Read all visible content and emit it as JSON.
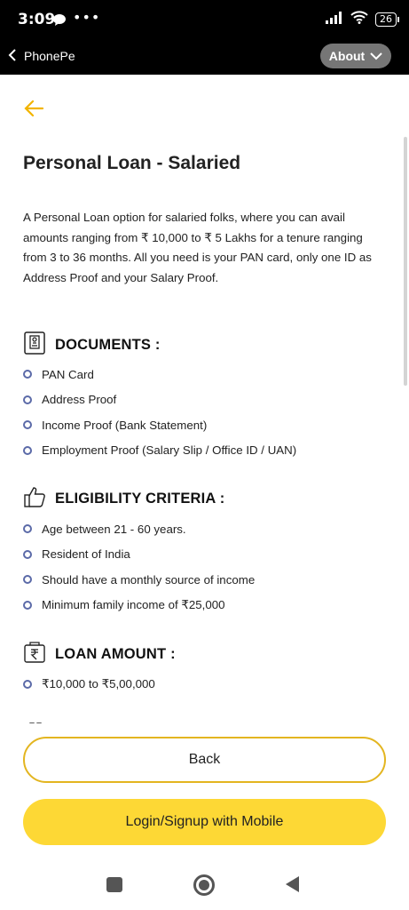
{
  "status_bar": {
    "time": "3:09",
    "dots": "•••",
    "battery": "26"
  },
  "app_bar": {
    "title": "PhonePe",
    "about_label": "About"
  },
  "page": {
    "title": "Personal Loan - Salaried",
    "description": "A Personal Loan option for salaried folks, where you can avail amounts ranging from ₹ 10,000 to ₹ 5 Lakhs for a tenure ranging from 3 to 36 months. All you need is your PAN card, only one ID as Address Proof and your Salary Proof."
  },
  "sections": {
    "documents": {
      "title": "DOCUMENTS :",
      "icon": "id-card-icon",
      "items": [
        "PAN Card",
        "Address Proof",
        "Income Proof (Bank Statement)",
        "Employment Proof (Salary Slip / Office ID / UAN)"
      ]
    },
    "eligibility": {
      "title": "ELIGIBILITY CRITERIA :",
      "icon": "thumbs-up-icon",
      "items": [
        "Age between 21 - 60 years.",
        "Resident of India",
        "Should have a monthly source of income",
        "Minimum family income of ₹25,000"
      ]
    },
    "loan_amount": {
      "title": "LOAN AMOUNT :",
      "icon": "rupee-wallet-icon",
      "items": [
        "₹10,000 to ₹5,00,000"
      ]
    }
  },
  "buttons": {
    "back_label": "Back",
    "login_label": "Login/Signup with Mobile"
  },
  "colors": {
    "accent": "#f2b400",
    "button_yellow": "#fdd835",
    "bullet": "#5b6aa8",
    "app_bar": "#000000"
  }
}
